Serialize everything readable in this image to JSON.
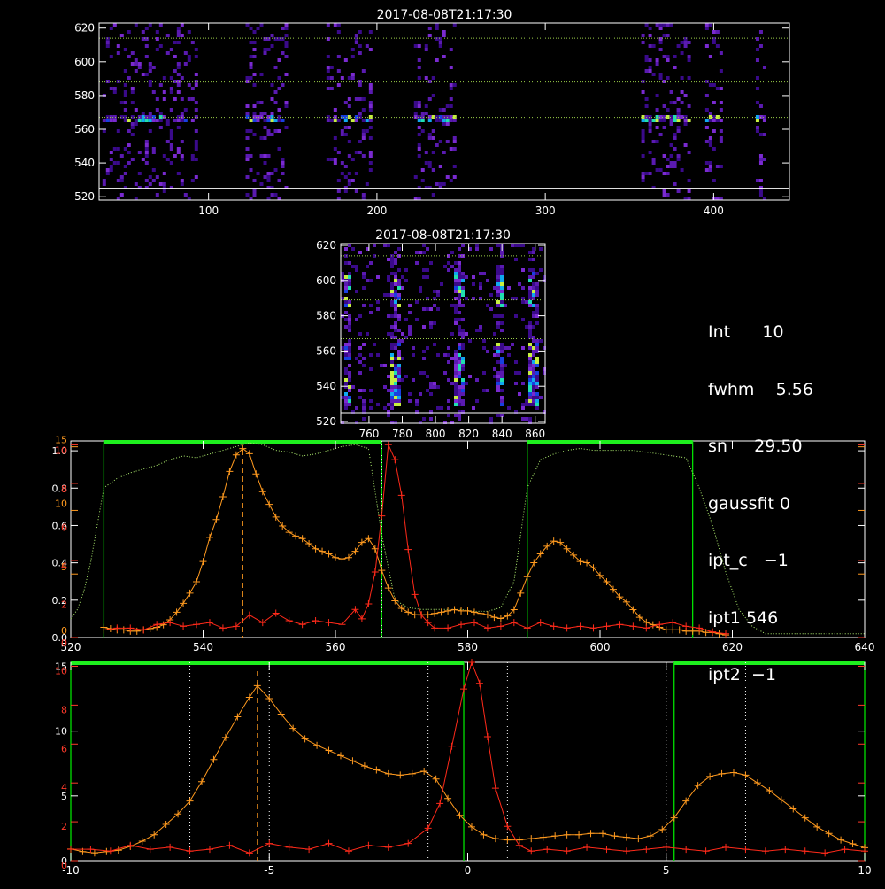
{
  "colors": {
    "background": "#000000",
    "axes": "#ffffff",
    "orange_profile": "#ff9a1f",
    "red_profile": "#ff2a1a",
    "green_filter": "#00e000",
    "bright_green": "#1ef01e"
  },
  "info_panel": {
    "rows": [
      {
        "label": "Int",
        "value": "10"
      },
      {
        "label": "fwhm",
        "value": "5.56"
      },
      {
        "label": "sn",
        "value": "29.50"
      },
      {
        "label": "gaussfit",
        "value": "0"
      },
      {
        "label": "ipt_c",
        "value": "−1"
      },
      {
        "label": "ipt1",
        "value": "546"
      },
      {
        "label": "ipt2",
        "value": "−1"
      }
    ]
  },
  "chart_data": [
    {
      "type": "heatmap",
      "title": "2017-08-08T21:17:30",
      "xlim": [
        35,
        445
      ],
      "ylim": [
        518,
        623
      ],
      "xticks": [
        100,
        200,
        300,
        400
      ],
      "yticks": [
        520,
        540,
        560,
        580,
        600,
        620
      ],
      "hlines_dotted": [
        614,
        588,
        567
      ],
      "hlines_solid": [
        525
      ],
      "bands_x": [
        [
          37,
          92
        ],
        [
          122,
          146
        ],
        [
          170,
          196
        ],
        [
          222,
          246
        ],
        [
          357,
          385
        ],
        [
          395,
          404
        ],
        [
          425,
          431
        ]
      ],
      "bright_row_y": 567
    },
    {
      "type": "heatmap",
      "title": "2017-08-08T21:17:30",
      "xlim": [
        743,
        866
      ],
      "ylim": [
        519,
        621
      ],
      "xticks": [
        760,
        780,
        800,
        820,
        840,
        860
      ],
      "yticks": [
        520,
        540,
        560,
        580,
        600,
        620
      ],
      "hlines_dotted": [
        614,
        589,
        567
      ],
      "hlines_solid": [
        525
      ],
      "bright_columns_x": [
        746,
        775,
        813,
        838,
        858
      ]
    },
    {
      "type": "line",
      "xlim": [
        520,
        640
      ],
      "xticks": [
        520,
        540,
        560,
        580,
        600,
        620,
        640
      ],
      "yticks_left_white": [
        "0.0",
        "0.2",
        "0.4",
        "0.6",
        "0.8",
        "1.0"
      ],
      "yticks_left_orange": [
        "0",
        "5",
        "10",
        "15"
      ],
      "yticks_left_red": [
        "0",
        "2",
        "4",
        "6",
        "8",
        "10"
      ],
      "filter_windows": [
        [
          525,
          567
        ],
        [
          589,
          614
        ]
      ],
      "vline_dashed": 546,
      "vline_dotted": 567,
      "series": [
        {
          "x": [
            520,
            521,
            522,
            523,
            524,
            525,
            527,
            529,
            531,
            533,
            535,
            537,
            539,
            541,
            543,
            545,
            547,
            549,
            551,
            553,
            555,
            557,
            559,
            561,
            563,
            565,
            567,
            569,
            571,
            573,
            575,
            577,
            579,
            581,
            583,
            585,
            587,
            589,
            591,
            593,
            595,
            597,
            599,
            601,
            603,
            605,
            607,
            609,
            611,
            613,
            615,
            617,
            619,
            621,
            623,
            625,
            630,
            635,
            640
          ],
          "values": [
            0.1,
            0.15,
            0.25,
            0.4,
            0.6,
            0.8,
            0.85,
            0.88,
            0.9,
            0.92,
            0.95,
            0.97,
            0.96,
            0.98,
            1.0,
            1.02,
            1.04,
            1.03,
            1.0,
            0.99,
            0.97,
            0.98,
            1.0,
            1.02,
            1.03,
            1.01,
            0.55,
            0.2,
            0.16,
            0.15,
            0.15,
            0.15,
            0.15,
            0.14,
            0.14,
            0.16,
            0.3,
            0.8,
            0.95,
            0.98,
            1.0,
            1.01,
            1.0,
            1.0,
            1.0,
            1.0,
            0.99,
            0.98,
            0.97,
            0.96,
            0.8,
            0.6,
            0.35,
            0.15,
            0.06,
            0.02,
            0.02,
            0.02,
            0.02
          ]
        },
        {
          "x": [
            525,
            526,
            527,
            528,
            529,
            530,
            531,
            532,
            533,
            534,
            535,
            536,
            537,
            538,
            539,
            540,
            541,
            542,
            543,
            544,
            545,
            546,
            547,
            548,
            549,
            550,
            551,
            552,
            553,
            554,
            555,
            556,
            557,
            558,
            559,
            560,
            561,
            562,
            563,
            564,
            565,
            566,
            567,
            568,
            569,
            570,
            571,
            572,
            573,
            574,
            575,
            576,
            577,
            578,
            579,
            580,
            581,
            582,
            583,
            584,
            585,
            586,
            587,
            588,
            589,
            590,
            591,
            592,
            593,
            594,
            595,
            596,
            597,
            598,
            599,
            600,
            601,
            602,
            603,
            604,
            605,
            606,
            607,
            608,
            609,
            610,
            611,
            612,
            613,
            614,
            615,
            616,
            617,
            618,
            619
          ],
          "values": [
            0.8,
            0.7,
            0.6,
            0.6,
            0.5,
            0.5,
            0.6,
            0.7,
            0.8,
            1.0,
            1.4,
            2.0,
            2.7,
            3.5,
            4.4,
            6.0,
            7.9,
            9.3,
            11.1,
            13.1,
            14.4,
            14.9,
            14.5,
            12.9,
            11.5,
            10.5,
            9.5,
            8.8,
            8.3,
            8.0,
            7.8,
            7.4,
            7.0,
            6.8,
            6.6,
            6.3,
            6.2,
            6.3,
            6.8,
            7.5,
            7.8,
            7.0,
            5.3,
            3.9,
            2.9,
            2.3,
            2.0,
            1.8,
            1.8,
            1.8,
            1.9,
            2.0,
            2.1,
            2.2,
            2.1,
            2.1,
            2.0,
            1.9,
            1.8,
            1.6,
            1.5,
            1.7,
            2.2,
            3.5,
            4.8,
            5.9,
            6.6,
            7.2,
            7.6,
            7.5,
            7.0,
            6.5,
            6.0,
            5.9,
            5.5,
            4.9,
            4.4,
            3.8,
            3.2,
            2.8,
            2.2,
            1.6,
            1.2,
            1.0,
            0.8,
            0.6,
            0.6,
            0.6,
            0.5,
            0.5,
            0.5,
            0.4,
            0.4,
            0.3,
            0.2
          ]
        },
        {
          "x": [
            525,
            527,
            529,
            531,
            533,
            535,
            537,
            539,
            541,
            543,
            545,
            547,
            549,
            551,
            553,
            555,
            557,
            559,
            561,
            563,
            564,
            565,
            566,
            567,
            568,
            569,
            570,
            571,
            572,
            573,
            574,
            575,
            577,
            579,
            581,
            583,
            585,
            587,
            589,
            591,
            593,
            595,
            597,
            599,
            601,
            603,
            605,
            607,
            609,
            611,
            613,
            615,
            617,
            619
          ],
          "values": [
            0.4,
            0.5,
            0.5,
            0.4,
            0.7,
            0.8,
            0.6,
            0.7,
            0.8,
            0.5,
            0.6,
            1.2,
            0.8,
            1.3,
            0.9,
            0.7,
            0.9,
            0.8,
            0.7,
            1.5,
            1.0,
            1.8,
            3.5,
            6.5,
            10.3,
            9.5,
            7.6,
            4.7,
            2.3,
            1.2,
            0.8,
            0.5,
            0.5,
            0.7,
            0.8,
            0.5,
            0.6,
            0.8,
            0.5,
            0.8,
            0.6,
            0.5,
            0.6,
            0.5,
            0.6,
            0.7,
            0.6,
            0.5,
            0.7,
            0.8,
            0.6,
            0.5,
            0.3,
            0.2
          ]
        }
      ]
    },
    {
      "type": "line",
      "xlim": [
        -10,
        10
      ],
      "xticks": [
        -10,
        -5,
        0,
        5,
        10
      ],
      "yticks_left_white": [
        "0",
        "5",
        "10",
        "15"
      ],
      "yticks_left_red": [
        "0",
        "2",
        "4",
        "6",
        "8",
        "10"
      ],
      "filter_windows": [
        [
          -10,
          -0.1
        ],
        [
          5.2,
          10
        ]
      ],
      "vline_dashed": -5.3,
      "vlines_dotted": [
        -7.0,
        -5.0,
        -1.0,
        1.0,
        5.0,
        7.0
      ],
      "series": [
        {
          "x": [
            -10,
            -9.7,
            -9.4,
            -9.1,
            -8.8,
            -8.5,
            -8.2,
            -7.9,
            -7.6,
            -7.3,
            -7.0,
            -6.7,
            -6.4,
            -6.1,
            -5.8,
            -5.5,
            -5.3,
            -5.0,
            -4.7,
            -4.4,
            -4.1,
            -3.8,
            -3.5,
            -3.2,
            -2.9,
            -2.6,
            -2.3,
            -2.0,
            -1.7,
            -1.4,
            -1.1,
            -0.8,
            -0.5,
            -0.2,
            0.1,
            0.4,
            0.7,
            1.0,
            1.3,
            1.6,
            1.9,
            2.2,
            2.5,
            2.8,
            3.1,
            3.4,
            3.7,
            4.0,
            4.3,
            4.6,
            4.9,
            5.2,
            5.5,
            5.8,
            6.1,
            6.4,
            6.7,
            7.0,
            7.3,
            7.6,
            7.9,
            8.2,
            8.5,
            8.8,
            9.1,
            9.4,
            9.7,
            10.0
          ],
          "values": [
            0.9,
            0.7,
            0.6,
            0.7,
            0.8,
            1.1,
            1.5,
            2.0,
            2.8,
            3.6,
            4.6,
            6.1,
            7.8,
            9.5,
            11.1,
            12.6,
            13.5,
            12.5,
            11.3,
            10.2,
            9.4,
            8.9,
            8.5,
            8.1,
            7.7,
            7.3,
            7.0,
            6.7,
            6.6,
            6.7,
            6.9,
            6.3,
            4.8,
            3.5,
            2.6,
            2.0,
            1.7,
            1.6,
            1.6,
            1.7,
            1.8,
            1.9,
            2.0,
            2.0,
            2.1,
            2.1,
            1.9,
            1.8,
            1.7,
            1.9,
            2.4,
            3.3,
            4.6,
            5.8,
            6.5,
            6.7,
            6.8,
            6.6,
            6.0,
            5.4,
            4.7,
            4.0,
            3.3,
            2.6,
            2.1,
            1.6,
            1.3,
            1.0
          ]
        },
        {
          "x": [
            -10,
            -9.5,
            -9.0,
            -8.5,
            -8.0,
            -7.5,
            -7.0,
            -6.5,
            -6.0,
            -5.5,
            -5.0,
            -4.5,
            -4.0,
            -3.5,
            -3.0,
            -2.5,
            -2.0,
            -1.5,
            -1.0,
            -0.7,
            -0.4,
            -0.1,
            0.1,
            0.3,
            0.5,
            0.7,
            1.0,
            1.3,
            1.6,
            2.0,
            2.5,
            3.0,
            3.5,
            4.0,
            4.5,
            5.0,
            5.5,
            6.0,
            6.5,
            7.0,
            7.5,
            8.0,
            8.5,
            9.0,
            9.5,
            10.0
          ],
          "values": [
            0.6,
            0.6,
            0.5,
            0.8,
            0.6,
            0.7,
            0.5,
            0.6,
            0.8,
            0.4,
            0.9,
            0.7,
            0.6,
            0.9,
            0.5,
            0.8,
            0.7,
            0.9,
            1.7,
            3.0,
            6.0,
            9.0,
            10.4,
            9.3,
            6.5,
            3.8,
            1.8,
            0.8,
            0.5,
            0.6,
            0.5,
            0.7,
            0.6,
            0.5,
            0.6,
            0.7,
            0.6,
            0.5,
            0.7,
            0.6,
            0.5,
            0.6,
            0.5,
            0.4,
            0.6,
            0.5
          ]
        }
      ]
    }
  ]
}
